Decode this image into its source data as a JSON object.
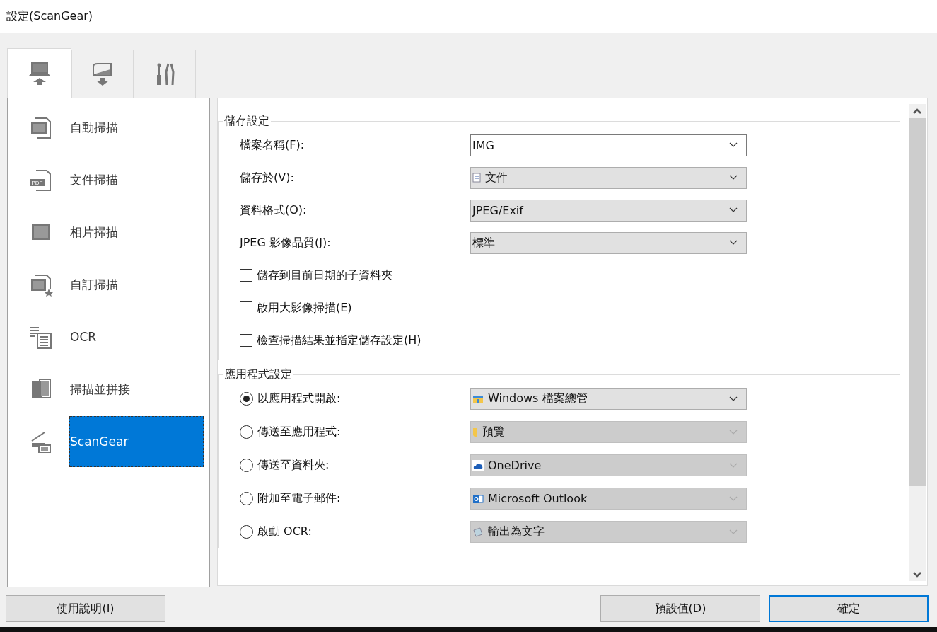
{
  "window": {
    "title": "設定(ScanGear)"
  },
  "tabs": [
    {
      "selected": true
    },
    {
      "selected": false
    },
    {
      "selected": false
    }
  ],
  "sidebar": {
    "items": [
      {
        "label": "自動掃描",
        "selected": false
      },
      {
        "icon_text": "PDF",
        "label": "文件掃描",
        "selected": false
      },
      {
        "label": "相片掃描",
        "selected": false
      },
      {
        "label": "自訂掃描",
        "selected": false
      },
      {
        "label": "OCR",
        "selected": false
      },
      {
        "label": "掃描並拼接",
        "selected": false
      },
      {
        "label": "ScanGear",
        "selected": true
      }
    ]
  },
  "save_settings": {
    "title": "儲存設定",
    "fields": [
      {
        "label": "檔案名稱(F):",
        "value": "IMG",
        "editable": true
      },
      {
        "label": "儲存於(V):",
        "value": "文件",
        "editable": false
      },
      {
        "label": "資料格式(O):",
        "value": "JPEG/Exif",
        "editable": false
      },
      {
        "label": "JPEG 影像品質(J):",
        "value": "標準",
        "editable": false
      }
    ],
    "checkboxes": [
      {
        "label": "儲存到目前日期的子資料夾",
        "checked": false
      },
      {
        "label": "啟用大影像掃描(E)",
        "checked": false
      },
      {
        "label": "檢查掃描結果並指定儲存設定(H)",
        "checked": false
      }
    ]
  },
  "app_settings": {
    "title": "應用程式設定",
    "options": [
      {
        "label": "以應用程式開啟:",
        "selected": true,
        "value": "Windows 檔案總管",
        "disabled": false
      },
      {
        "label": "傳送至應用程式:",
        "selected": false,
        "value": "預覽",
        "disabled": true
      },
      {
        "label": "傳送至資料夾:",
        "selected": false,
        "value": "OneDrive",
        "disabled": true
      },
      {
        "label": "附加至電子郵件:",
        "selected": false,
        "value": "Microsoft Outlook",
        "disabled": true
      },
      {
        "label": "啟動 OCR:",
        "selected": false,
        "value": "輸出為文字",
        "disabled": true
      }
    ]
  },
  "buttons": {
    "help": "使用說明(I)",
    "defaults": "預設值(D)",
    "ok": "確定"
  }
}
